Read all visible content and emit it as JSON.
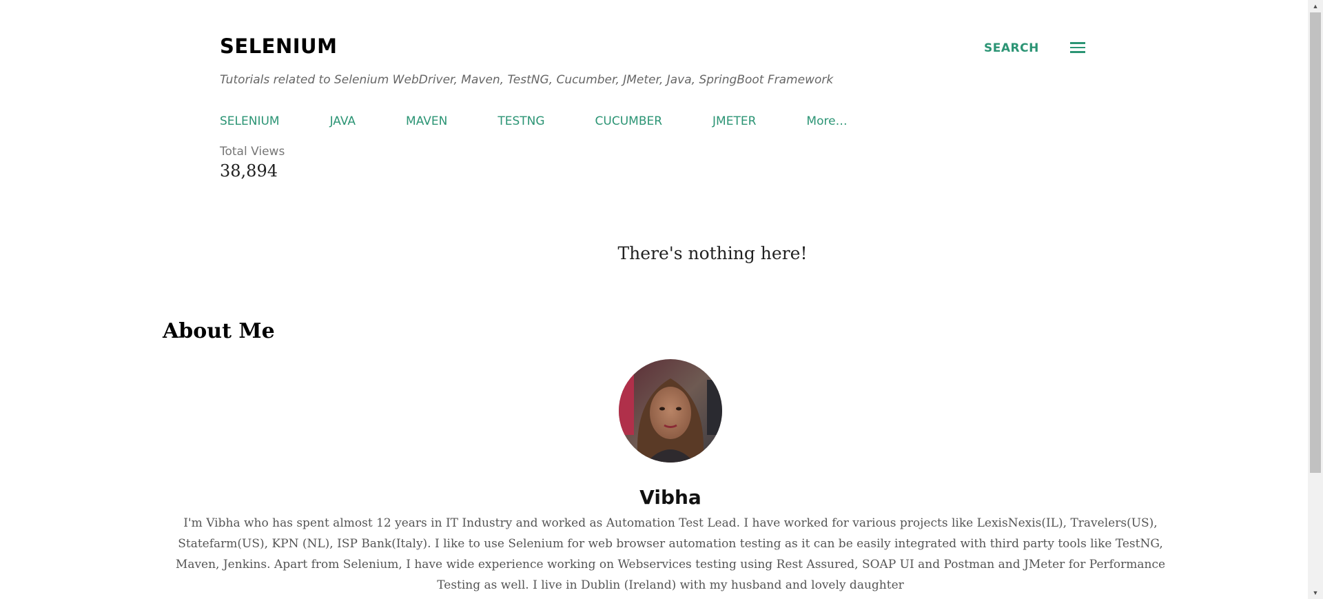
{
  "header": {
    "title": "SELENIUM",
    "description": "Tutorials related to Selenium WebDriver, Maven, TestNG, Cucumber, JMeter, Java, SpringBoot Framework",
    "search_label": "SEARCH",
    "menu_icon": "hamburger-menu-icon"
  },
  "nav": {
    "tabs": [
      {
        "label": "SELENIUM"
      },
      {
        "label": "JAVA"
      },
      {
        "label": "MAVEN"
      },
      {
        "label": "TESTNG"
      },
      {
        "label": "CUCUMBER"
      },
      {
        "label": "JMETER"
      },
      {
        "label": "More…"
      }
    ]
  },
  "stats": {
    "label": "Total Views",
    "value": "38,894"
  },
  "main": {
    "empty_message": "There's nothing here!"
  },
  "about": {
    "heading": "About Me",
    "name": "Vibha",
    "bio": "I'm Vibha who has spent almost 12 years in IT Industry and worked as Automation Test Lead. I have worked for various projects like LexisNexis(IL), Travelers(US), Statefarm(US), KPN (NL), ISP Bank(Italy). I like to use Selenium for web browser automation testing as it can be easily integrated with third party tools like TestNG, Maven, Jenkins. Apart from Selenium, I have wide experience working on Webservices testing using Rest Assured, SOAP UI and Postman and JMeter for Performance Testing as well. I live in Dublin (Ireland) with my husband and lovely daughter"
  },
  "colors": {
    "accent": "#2b9474",
    "text": "#212121",
    "muted": "#757575"
  }
}
